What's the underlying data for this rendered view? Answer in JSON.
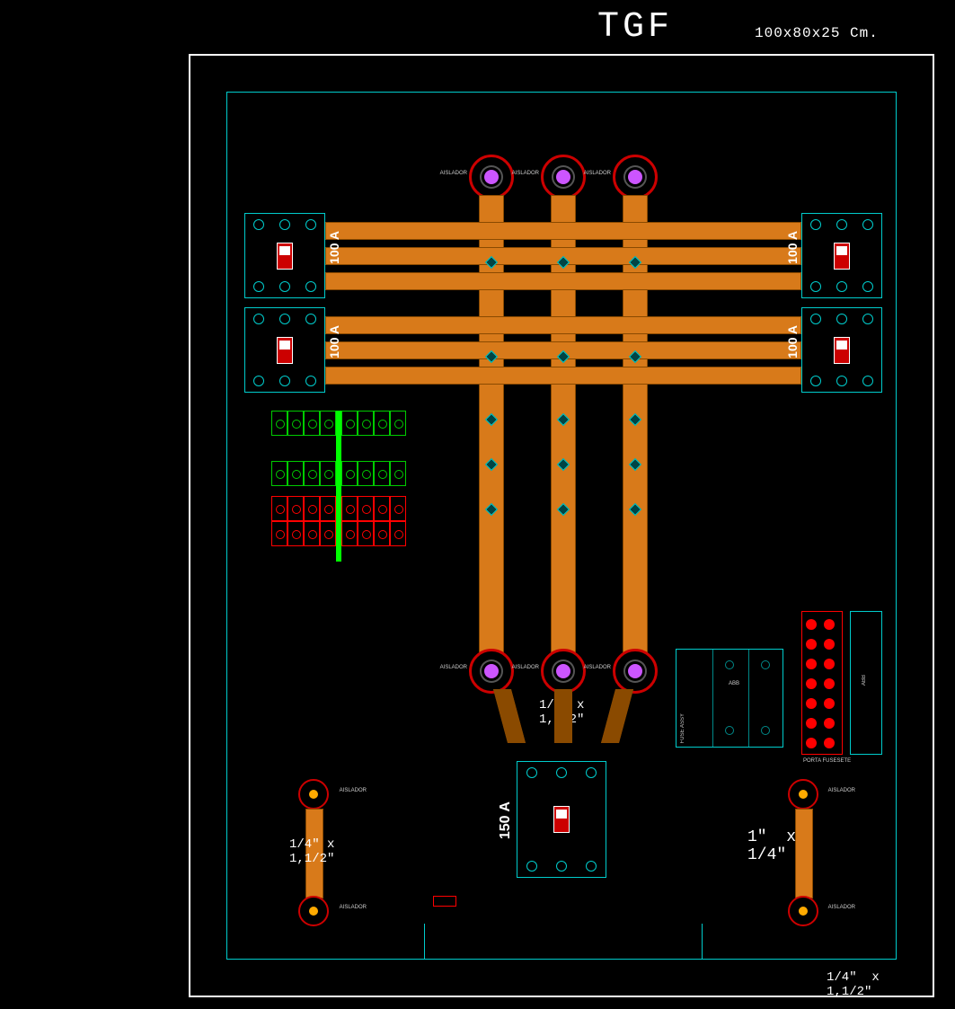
{
  "header": {
    "title": "TGF",
    "dimensions": "100x80x25 Cm."
  },
  "breakers": {
    "top_left_1": "100 A",
    "top_left_2": "100 A",
    "top_right_1": "100 A",
    "top_right_2": "100 A",
    "main": "150 A"
  },
  "busbar_notes": {
    "mid": "1/4\" x\n1,1/2\"",
    "left_ground": "1/4\" x\n1,1/2\"",
    "right_ground": "1\"  x\n1/4\"",
    "bottom": "1/4\"  x\n1,1/2\""
  },
  "labels": {
    "fuse_block": "FUSE  ASSY",
    "fuse_brand": "ABB",
    "din_brand": "ABB",
    "din_note": "PORTA FUSESETE"
  },
  "colors": {
    "copper": "#d87a1a",
    "cyan": "#0cc",
    "red": "#c00",
    "green": "#0c0"
  }
}
